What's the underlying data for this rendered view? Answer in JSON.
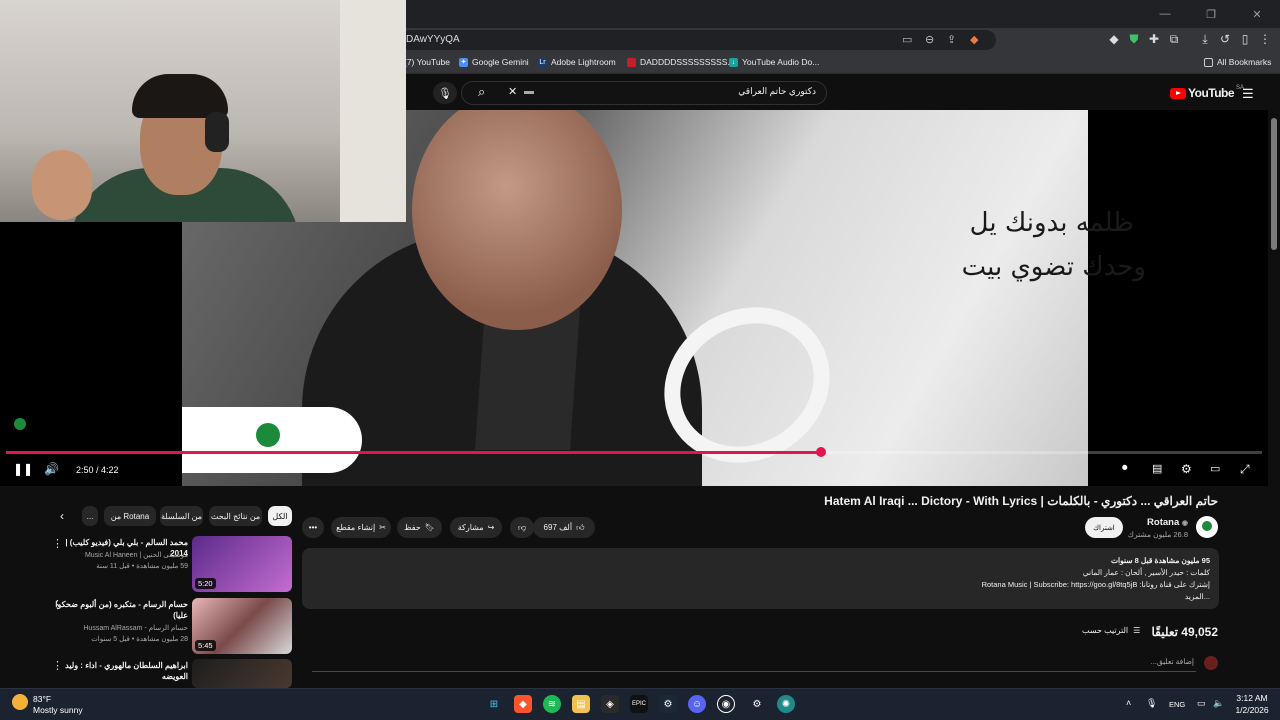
{
  "browser": {
    "url": "DAwYYyQA",
    "bookmarks": [
      {
        "label": "(7) YouTube",
        "icon": "youtube-icon",
        "color": "#ff0000"
      },
      {
        "label": "Google Gemini",
        "icon": "gemini-icon",
        "color": "#4f8df7"
      },
      {
        "label": "Adobe Lightroom",
        "icon": "lightroom-icon",
        "color": "#1c3a6e"
      },
      {
        "label": "DADDDDSSSSSSSSS...",
        "icon": "bookmark-red-icon",
        "color": "#c41e2a"
      },
      {
        "label": "YouTube Audio Do...",
        "icon": "download-icon",
        "color": "#1aa39b"
      }
    ],
    "all_bookmarks": "All Bookmarks"
  },
  "youtube": {
    "search_query": "دكتوري حاتم العراقي",
    "logo_word": "YouTube",
    "logo_region": "SA"
  },
  "player": {
    "lyric_line1": "ظلمه بدونك يل",
    "lyric_line2": "وحدك تضوي بيت",
    "time": "2:50 / 4:22",
    "progress": 0.649,
    "accent": "#e2164f"
  },
  "video": {
    "title": "حاتم العراقي ... دكتوري - بالكلمات | Hatem Al Iraqi ... Dictory - With Lyrics",
    "channel": "Rotana",
    "subs": "26.8 مليون مشترك",
    "subscribe": "اشتراك",
    "likes": "697 ألف",
    "share": "مشاركة",
    "save": "حفظ",
    "clip": "إنشاء مقطع",
    "description_lines": [
      "95 مليون مشاهدة  قبل 8 سنوات",
      "كلمات : حيدر الأسير , ألحان : عمار الماني",
      "إشترك على قناة روتانا: Rotana Music | Subscribe: https://goo.gl/8tq5jB",
      "...المزيد"
    ],
    "description_link": "https://goo.gl/8tq5jB",
    "comments_count": "49,052 تعليقًا",
    "sort_label": "الترتيب حسب",
    "add_comment": "إضافة تعليق..."
  },
  "chips": [
    "الكل",
    "من نتائج البحث",
    "من السلسلة",
    "من Rotana",
    "..."
  ],
  "recommendations": [
    {
      "title": "محمد السالم - بلي بلي (فيديو كليب) | 2014",
      "channel": "موسيقى الحنين | Music Al Haneen",
      "meta": "59 مليون مشاهدة • قبل 11 سنة",
      "duration": "5:20"
    },
    {
      "title": "حسام الرسام - متكبره (من ألبوم ضحكوا عليا)",
      "channel": "حسام الرسام - Hussam AlRassam",
      "meta": "28 مليون مشاهدة • قبل 5 سنوات",
      "duration": "5:45"
    },
    {
      "title": "ابراهيم السلطان مالهوري - اداء : وليد العويضه",
      "channel": "",
      "meta": "",
      "duration": ""
    }
  ],
  "taskbar": {
    "temp": "83°F",
    "weather": "Mostly sunny",
    "lang": "ENG",
    "time": "3:12 AM",
    "date": "1/2/2026"
  }
}
